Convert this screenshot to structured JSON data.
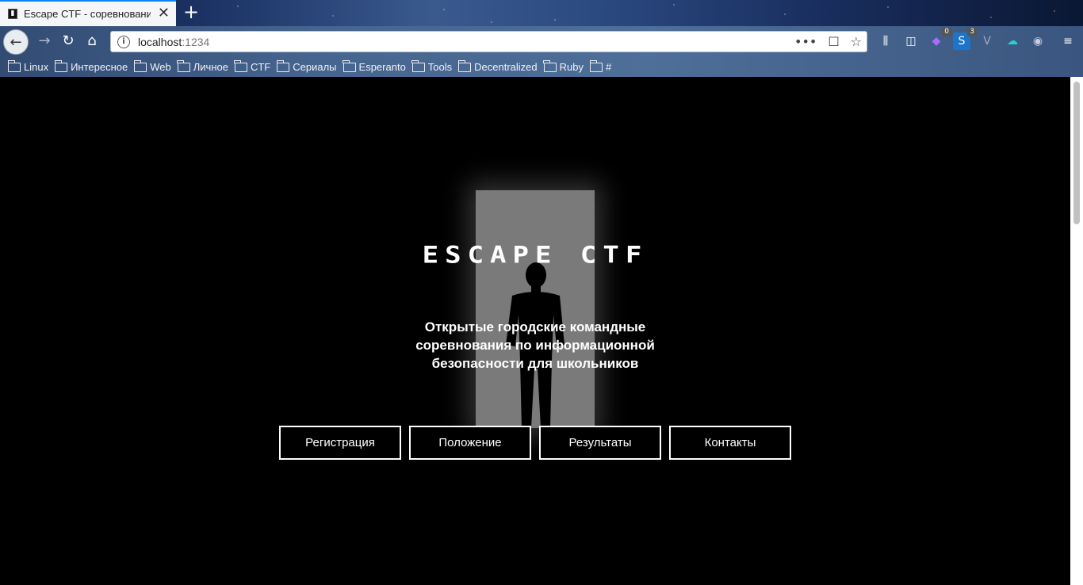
{
  "browser": {
    "tab": {
      "favicon_char": "▮",
      "title": "Escape CTF - соревновани",
      "close": "✕"
    },
    "new_tab": "+",
    "url": {
      "host": "localhost",
      "port": ":1234",
      "actions": [
        "•••",
        "☐",
        "☆"
      ]
    },
    "toolbar_badges": {
      "ext1": "0",
      "ext2": "3"
    },
    "bookmarks": [
      "Linux",
      "Интересное",
      "Web",
      "Личное",
      "CTF",
      "Сериалы",
      "Esperanto",
      "Tools",
      "Decentralized",
      "Ruby",
      "#"
    ]
  },
  "page": {
    "logo": "ESCAPE CTF",
    "subtitle": "Открытые городские командные соревнования по информационной безопасности для школьников",
    "nav": [
      "Регистрация",
      "Положение",
      "Результаты",
      "Контакты"
    ]
  },
  "colors": {
    "accent": "#0a84ff",
    "door": "#7a7a7a",
    "background": "#000000"
  }
}
